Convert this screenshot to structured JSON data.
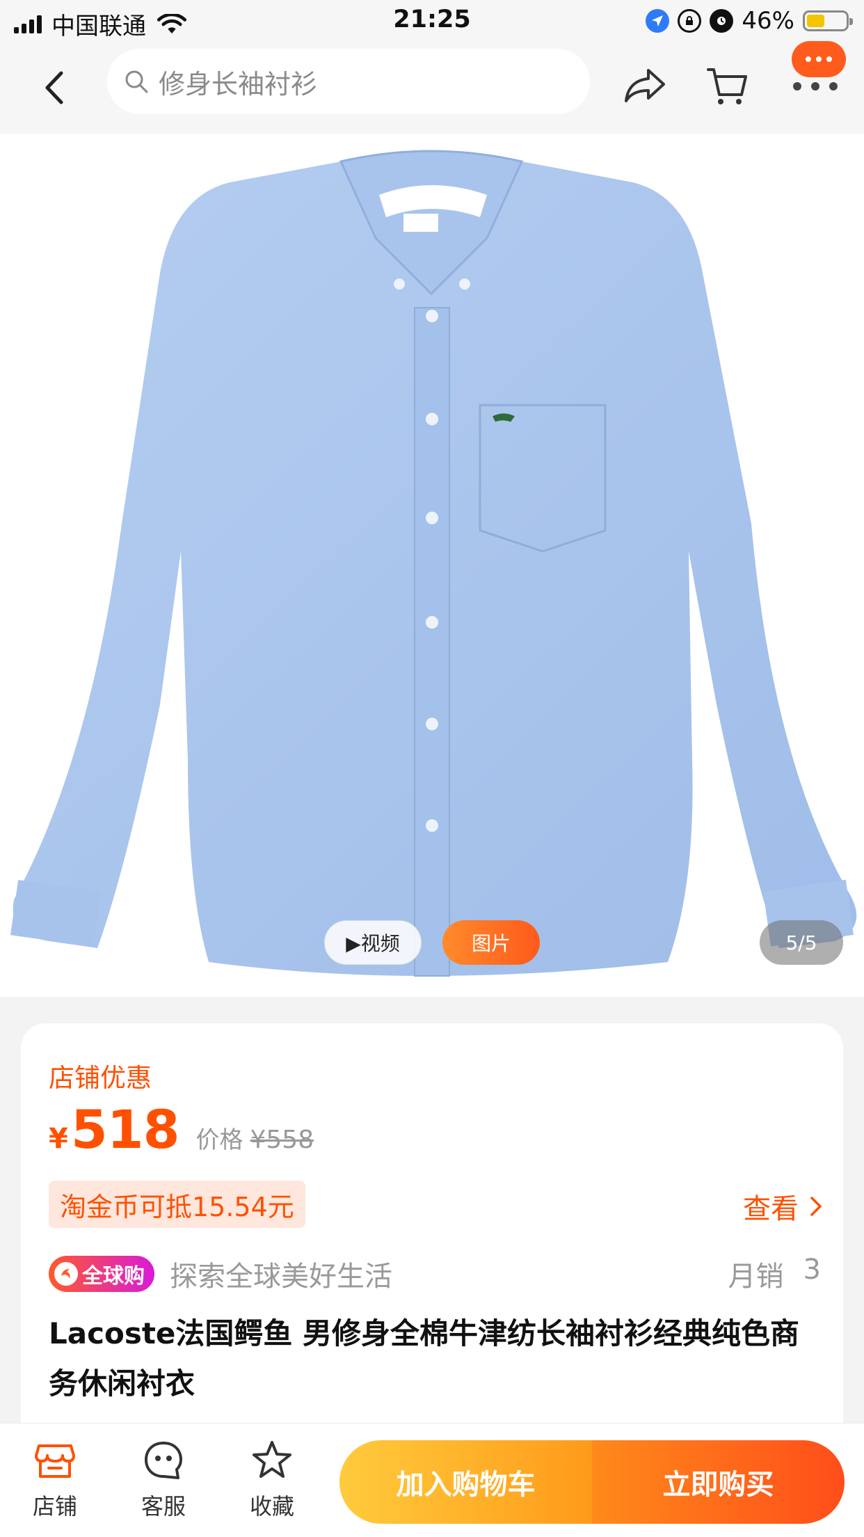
{
  "status_bar": {
    "carrier": "中国联通",
    "time": "21:25",
    "battery_percent": "46%",
    "battery_level": 0.46
  },
  "nav": {
    "search_text": "修身长袖衬衫",
    "icons": [
      "back-icon",
      "search-icon",
      "share-icon",
      "cart-icon",
      "more-icon"
    ],
    "badge_color": "#ff5b1c"
  },
  "gallery": {
    "video_tab": "▶视频",
    "image_tab": "图片",
    "pager": "5/5",
    "image_description_color": "#a9c4ec"
  },
  "product": {
    "promo_label": "店铺优惠",
    "currency": "¥",
    "price": "518",
    "original_label": "价格",
    "original_price": "¥558",
    "coin_deduction": "淘金币可抵15.54元",
    "view_link": "查看",
    "global_badge": "全球购",
    "global_slogan": "探索全球美好生活",
    "monthly_sales_label": "月销",
    "monthly_sales_value": "3",
    "title": "Lacoste法国鳄鱼 男修身全棉牛津纺长袖衬衫经典纯色商务休闲衬衣",
    "accent_color": "#ff5000"
  },
  "bottom_bar": {
    "store": "店铺",
    "service": "客服",
    "favorite": "收藏",
    "add_to_cart": "加入购物车",
    "buy_now": "立即购买"
  }
}
